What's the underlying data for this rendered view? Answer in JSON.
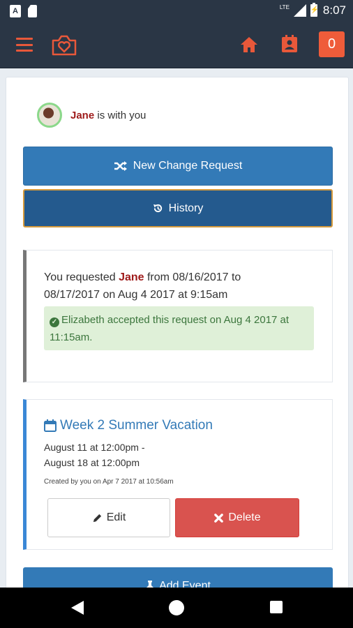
{
  "status_bar": {
    "time": "8:07",
    "network": "LTE",
    "icons": [
      "a-icon",
      "document-icon",
      "signal-icon",
      "battery-icon"
    ]
  },
  "app_bar": {
    "icons": [
      "menu-icon",
      "camera-heart-logo",
      "home-icon",
      "calendar-person-icon"
    ],
    "notification_count": "0",
    "accent_color": "#e8583a",
    "background_color": "#2a3645"
  },
  "custody": {
    "child_name": "Jane",
    "with_you_text": "is with you"
  },
  "actions": {
    "new_change_request": "New Change Request",
    "history": "History",
    "add_event": "Add Event"
  },
  "request_card": {
    "prefix": "You requested",
    "child": "Jane",
    "details": "from 08/16/2017 to 08/17/2017 on Aug 4 2017 at 9:15am",
    "status": "Elizabeth accepted this request on Aug 4 2017 at 11:15am.",
    "status_color": "#3c763d"
  },
  "event_card": {
    "title": "Week 2 Summer Vacation",
    "start": "August 11 at 12:00pm -",
    "end": "August 18 at 12:00pm",
    "meta": "Created by you on Apr 7 2017 at 10:56am",
    "edit_label": "Edit",
    "delete_label": "Delete"
  }
}
